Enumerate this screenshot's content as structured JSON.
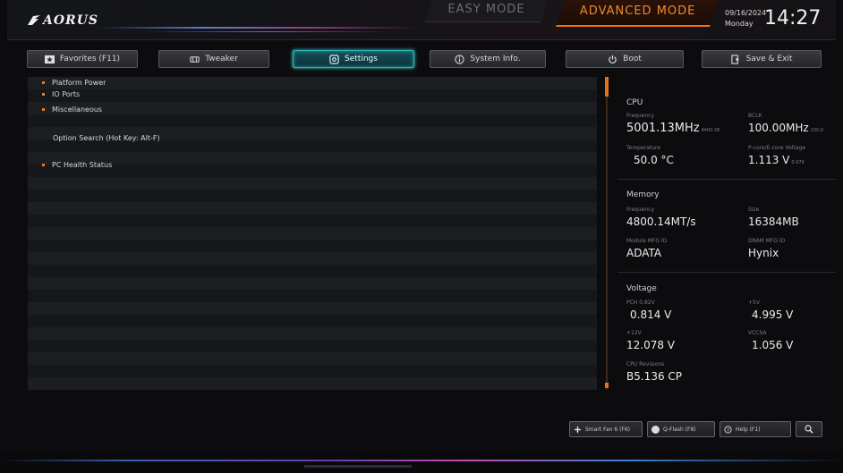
{
  "header": {
    "logo_text": "AORUS",
    "easy_mode": "EASY MODE",
    "advanced_mode": "ADVANCED MODE",
    "date": "09/16/2024",
    "day": "Monday",
    "time": "14:27"
  },
  "tabs": [
    {
      "label": "Favorites (F11)",
      "icon": "star-icon"
    },
    {
      "label": "Tweaker",
      "icon": "tweaker-icon"
    },
    {
      "label": "Settings",
      "icon": "gear-icon",
      "active": true
    },
    {
      "label": "System Info.",
      "icon": "info-icon"
    },
    {
      "label": "Boot",
      "icon": "power-icon"
    },
    {
      "label": "Save & Exit",
      "icon": "exit-icon"
    }
  ],
  "menu": {
    "items": [
      {
        "label": "Platform Power",
        "bullet": true
      },
      {
        "label": "IO Ports",
        "bullet": true
      },
      {
        "label": "Miscellaneous",
        "bullet": true
      },
      {
        "label": "Option Search (Hot Key: Alt-F)",
        "bullet": false
      },
      {
        "label": "PC Health Status",
        "bullet": true
      }
    ]
  },
  "info": {
    "cpu": {
      "title": "CPU",
      "freq_label": "Frequency",
      "freq_value": "5001.13MHz",
      "freq_sub": "4400.38",
      "bclk_label": "BCLK",
      "bclk_value": "100.00MHz",
      "bclk_sub": "100.0",
      "temp_label": "Temperature",
      "temp_value": "50.0 °C",
      "volt_label": "P-core/E-core Voltage",
      "volt_value": "1.113 V",
      "volt_sub": "0.979"
    },
    "memory": {
      "title": "Memory",
      "freq_label": "Frequency",
      "freq_value": "4800.14MT/s",
      "size_label": "Size",
      "size_value": "16384MB",
      "module_label": "Module MFG ID",
      "module_value": "ADATA",
      "dram_label": "DRAM MFG ID",
      "dram_value": "Hynix"
    },
    "voltage": {
      "title": "Voltage",
      "pch_label": "PCH 0.82V",
      "pch_value": "0.814 V",
      "v5_label": "+5V",
      "v5_value": "4.995 V",
      "v12_label": "+12V",
      "v12_value": "12.078 V",
      "vccsa_label": "VCCSA",
      "vccsa_value": "1.056 V",
      "cpu_rev_label": "CPU Revisions",
      "cpu_rev_value": "B5.136 CP"
    }
  },
  "bottom_buttons": [
    {
      "label": "Smart Fan 6 (F6)",
      "icon": "fan-icon"
    },
    {
      "label": "Q-Flash (F8)",
      "icon": "qflash-icon"
    },
    {
      "label": "Help (F1)",
      "icon": "help-icon"
    },
    {
      "label": "",
      "icon": "search-icon"
    }
  ],
  "colors": {
    "accent": "#e8701a",
    "active_tab": "#2fb3b8",
    "background": "#0c0c0e"
  }
}
